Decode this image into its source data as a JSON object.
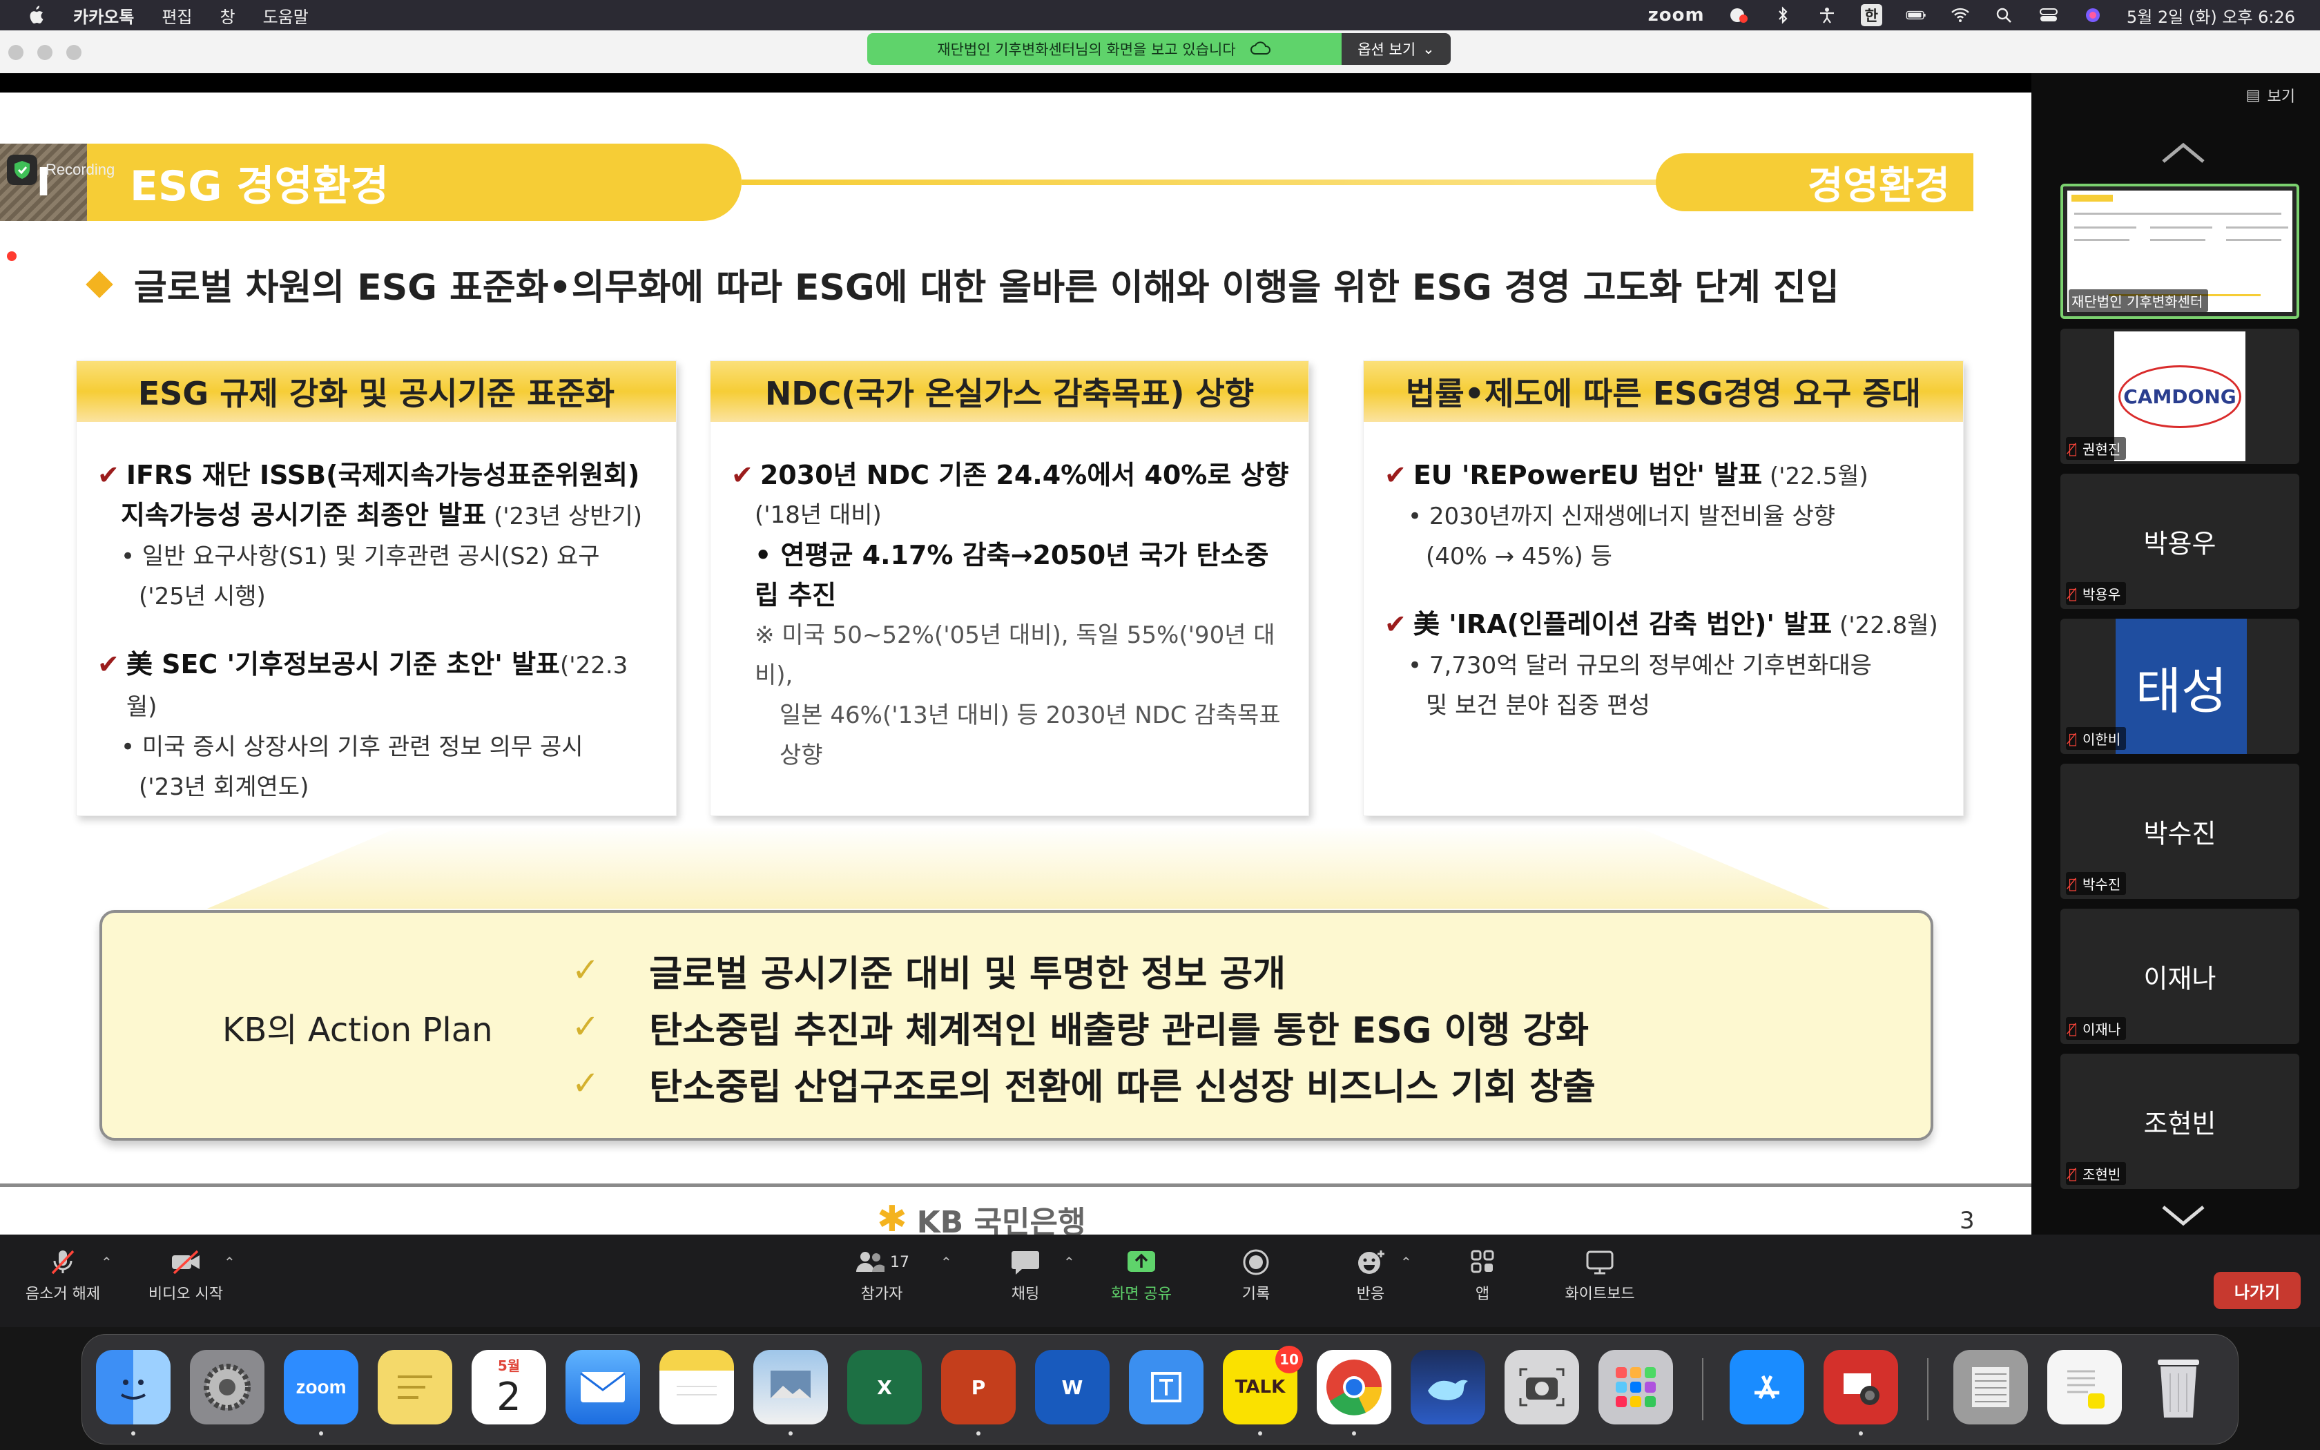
{
  "menubar": {
    "app": "카카오톡",
    "menus": [
      "편집",
      "창",
      "도움말"
    ],
    "zoom_label": "zoom",
    "input_method": "한",
    "datetime": "5월 2일 (화) 오후 6:26",
    "icons": [
      "apple-logo-icon",
      "zoom-status-icon",
      "bluetooth-icon",
      "accessibility-icon",
      "battery-icon",
      "wifi-icon",
      "search-icon",
      "control-center-icon",
      "siri-icon"
    ]
  },
  "share_bar": {
    "notice": "재단법인 기후변화센터님의 화면을 보고 있습니다",
    "options": "옵션 보기"
  },
  "recording": {
    "label": "Recording"
  },
  "slide": {
    "section_num": "I",
    "section_title": "ESG 경영환경",
    "section_tag": "경영환경",
    "headline": "글로벌 차원의 ESG 표준화•의무화에 따라 ESG에 대한 올바른 이해와 이행을 위한 ESG 경영 고도화 단계 진입",
    "boxes": [
      {
        "header": "ESG 규제 강화 및 공시기준 표준화",
        "items": [
          {
            "bold": "IFRS 재단 ISSB(국제지속가능성표준위원회)",
            "line2_bold": "지속가능성 공시기준 최종안 발표",
            "line2_rest": " ('23년 상반기)"
          },
          {
            "sub1": "• 일반 요구사항(S1) 및 기후관련 공시(S2) 요구",
            "sub2": "('25년 시행)"
          },
          {
            "bold": "美 SEC '기후정보공시 기준 초안' 발표",
            "rest": "('22.3월)"
          },
          {
            "sub1": "• 미국 증시 상장사의 기후 관련 정보 의무 공시",
            "sub2": "('23년 회계연도)"
          }
        ]
      },
      {
        "header": "NDC(국가 온실가스 감축목표) 상향",
        "items": [
          {
            "bold": "2030년 NDC 기존 24.4%에서 40%로 상향",
            "sub": "('18년 대비)"
          },
          {
            "bold2": "• 연평균 4.17% 감축→2050년 국가 탄소중립 추진"
          },
          {
            "note1": "※ 미국 50~52%('05년 대비), 독일 55%('90년 대비),",
            "note2": "일본 46%('13년 대비) 등 2030년 NDC 감축목표 상향"
          }
        ]
      },
      {
        "header": "법률•제도에 따른 ESG경영 요구 증대",
        "items": [
          {
            "bold": "EU 'REPowerEU 법안' 발표",
            "rest": " ('22.5월)"
          },
          {
            "sub1": "• 2030년까지 신재생에너지 발전비율 상향",
            "sub2": "(40% → 45%) 등"
          },
          {
            "bold": "美 'IRA(인플레이션 감축 법안)' 발표",
            "rest": " ('22.8월)"
          },
          {
            "sub1": "• 7,730억 달러 규모의 정부예산 기후변화대응",
            "sub2": "및 보건 분야 집중 편성"
          }
        ]
      }
    ],
    "action_plan": {
      "label": "KB의 Action Plan",
      "lines": [
        "글로벌 공시기준 대비 및 투명한 정보 공개",
        "탄소중립 추진과 체계적인 배출량 관리를 통한 ESG 이행 강화",
        "탄소중립 산업구조로의 전환에 따른 신성장 비즈니스 기회 창출"
      ]
    },
    "footer_brand": "KB 국민은행",
    "page_number": "3"
  },
  "panel": {
    "view_label": "보기",
    "participants": [
      {
        "name": "재단법인 기후변화센터",
        "caption": "재단법인 기후변화센터",
        "type": "screen"
      },
      {
        "name": "권현진",
        "caption": "권현진",
        "type": "logo",
        "logo_text": "CAMDONG"
      },
      {
        "name": "박용우",
        "caption": "박용우",
        "type": "name"
      },
      {
        "name": "이한비",
        "caption": "이한비",
        "type": "avatar",
        "avatar_text": "태성"
      },
      {
        "name": "박수진",
        "caption": "박수진",
        "type": "name"
      },
      {
        "name": "이재나",
        "caption": "이재나",
        "type": "name"
      },
      {
        "name": "조현빈",
        "caption": "조현빈",
        "type": "name"
      }
    ]
  },
  "toolbar": {
    "unmute": "음소거 해제",
    "start_video": "비디오 시작",
    "participants": "참가자",
    "participants_count": "17",
    "chat": "채팅",
    "share_screen": "화면 공유",
    "record": "기록",
    "reactions": "반응",
    "apps": "앱",
    "whiteboard": "화이트보드",
    "leave": "나가기"
  },
  "dock": {
    "calendar_month": "5월",
    "calendar_day": "2",
    "kakao_label": "TALK",
    "kakao_badge": "10",
    "zoom_label": "zoom",
    "apps": [
      "finder",
      "system-settings",
      "zoom",
      "stickies",
      "calendar",
      "mail",
      "notes",
      "preview",
      "excel",
      "powerpoint",
      "word",
      "hancom",
      "kakaotalk",
      "chrome",
      "whale",
      "screenshot",
      "launchpad",
      "app-store",
      "photo-booth",
      "downloads",
      "recent",
      "trash"
    ],
    "colors": {
      "zoom": "#2d8cff",
      "excel": "#1d7044",
      "powerpoint": "#c43e1c",
      "word": "#185abd",
      "kakao": "#fae100",
      "appstore": "#1a8cff"
    }
  }
}
